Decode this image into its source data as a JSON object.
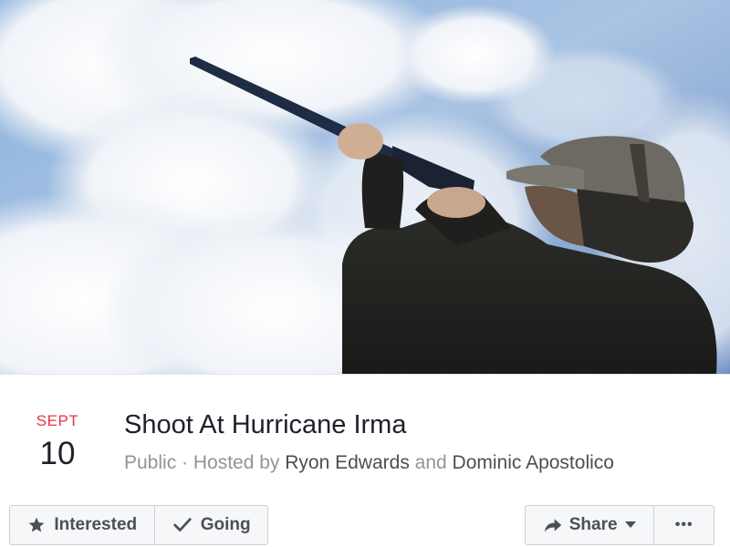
{
  "cover": {
    "icon": "cover-photo-hunter-aiming-shotgun-at-sky"
  },
  "event": {
    "month": "SEPT",
    "day": "10",
    "title": "Shoot At Hurricane Irma",
    "privacy": "Public",
    "separator": " · ",
    "hosted_by_prefix": "Hosted by ",
    "host_1": "Ryon Edwards",
    "conjunction": " and ",
    "host_2": "Dominic Apostolico"
  },
  "actions": {
    "interested_label": "Interested",
    "going_label": "Going",
    "share_label": "Share",
    "more_label": "•••",
    "icons": [
      "star-icon",
      "checkmark-icon",
      "share-arrow-icon",
      "caret-down-icon"
    ]
  },
  "colors": {
    "month_accent": "#e0393e",
    "title": "#1d2129",
    "muted_text": "#90949c",
    "host_link": "#4b4f56",
    "button_bg": "#f6f7f9",
    "button_border": "#ccd0d5"
  }
}
